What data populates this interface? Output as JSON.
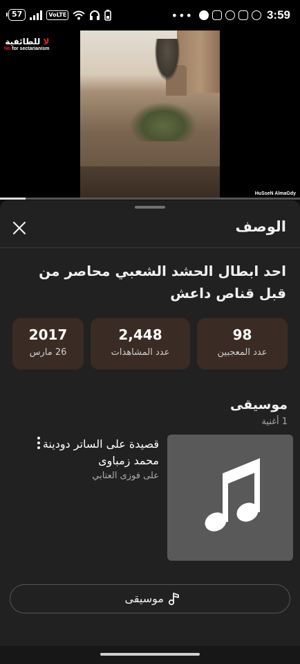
{
  "status_bar": {
    "battery": "57",
    "volte": "VoLTE",
    "overflow": "•••",
    "time": "3:59",
    "icons": [
      "battery-icon",
      "signal-icon",
      "volte-icon",
      "wifi-icon",
      "headphones-icon",
      "battery-charging-icon",
      "facebook-icon",
      "instagram-icon",
      "messenger-icon",
      "instagram-icon",
      "whatsapp-icon"
    ]
  },
  "video": {
    "watermark_ar_no": "لا",
    "watermark_ar_text": "للطائفية",
    "watermark_en_no": "No",
    "watermark_en_text": "for sectarianism",
    "credit": "HuSseN AlmaGdy",
    "progress": 0.085
  },
  "sheet": {
    "header_title": "الوصف",
    "video_title": "احد ابطال الحشد الشعبي محاصر من قبل قناص داعش",
    "stats": [
      {
        "value": "98",
        "label": "عدد المعجبين"
      },
      {
        "value": "2,448",
        "label": "عدد المشاهدات"
      },
      {
        "value": "2017",
        "label": "26 مارس"
      }
    ],
    "music": {
      "heading": "موسيقى",
      "count": "1 أغنية",
      "track_title": "قصيدة على الساتر دودينة محمد زمباوى",
      "track_artist": "على فوزى العتابي",
      "button_label": "موسيقى"
    }
  },
  "colors": {
    "sheet_bg": "#212121",
    "stat_bg": "#3a2c24",
    "art_bg": "#595959"
  }
}
